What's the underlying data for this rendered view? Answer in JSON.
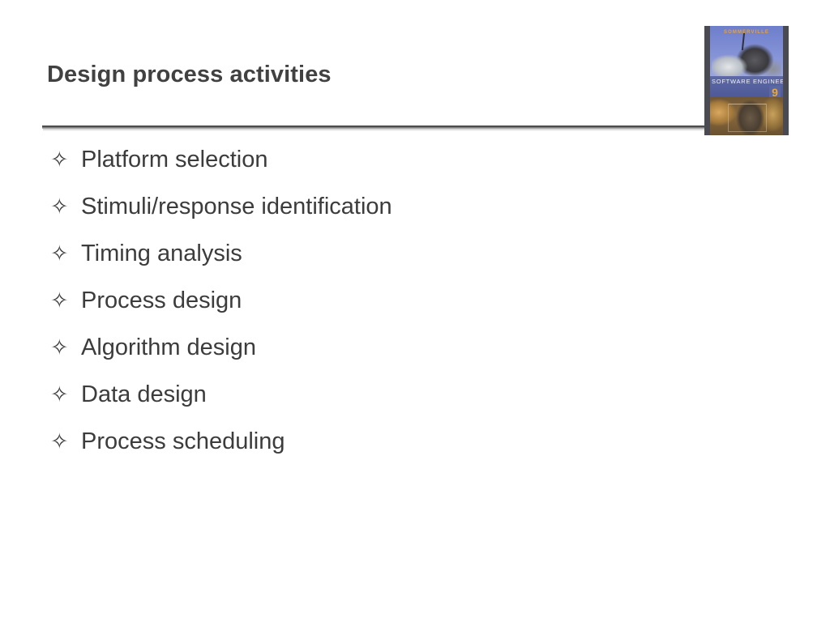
{
  "slide": {
    "title": "Design process activities",
    "bullet_glyph": "✧",
    "bullets": [
      {
        "text": "Platform selection"
      },
      {
        "text": "Stimuli/response identification"
      },
      {
        "text": "Timing analysis"
      },
      {
        "text": "Process design"
      },
      {
        "text": "Algorithm design"
      },
      {
        "text": "Data design"
      },
      {
        "text": "Process scheduling"
      }
    ],
    "colors": {
      "background": "#ffffff",
      "title_text": "#414141",
      "body_text": "#3c3c3c",
      "rule": "#3d3d3d"
    }
  },
  "book_cover": {
    "author": "SOMMERVILLE",
    "title": "SOFTWARE ENGINEERING",
    "edition": "9",
    "colors": {
      "sky": "#7c8ad2",
      "band": "#4e5a97",
      "edition_text": "#eda63c",
      "frame": "#4a4a52"
    }
  }
}
